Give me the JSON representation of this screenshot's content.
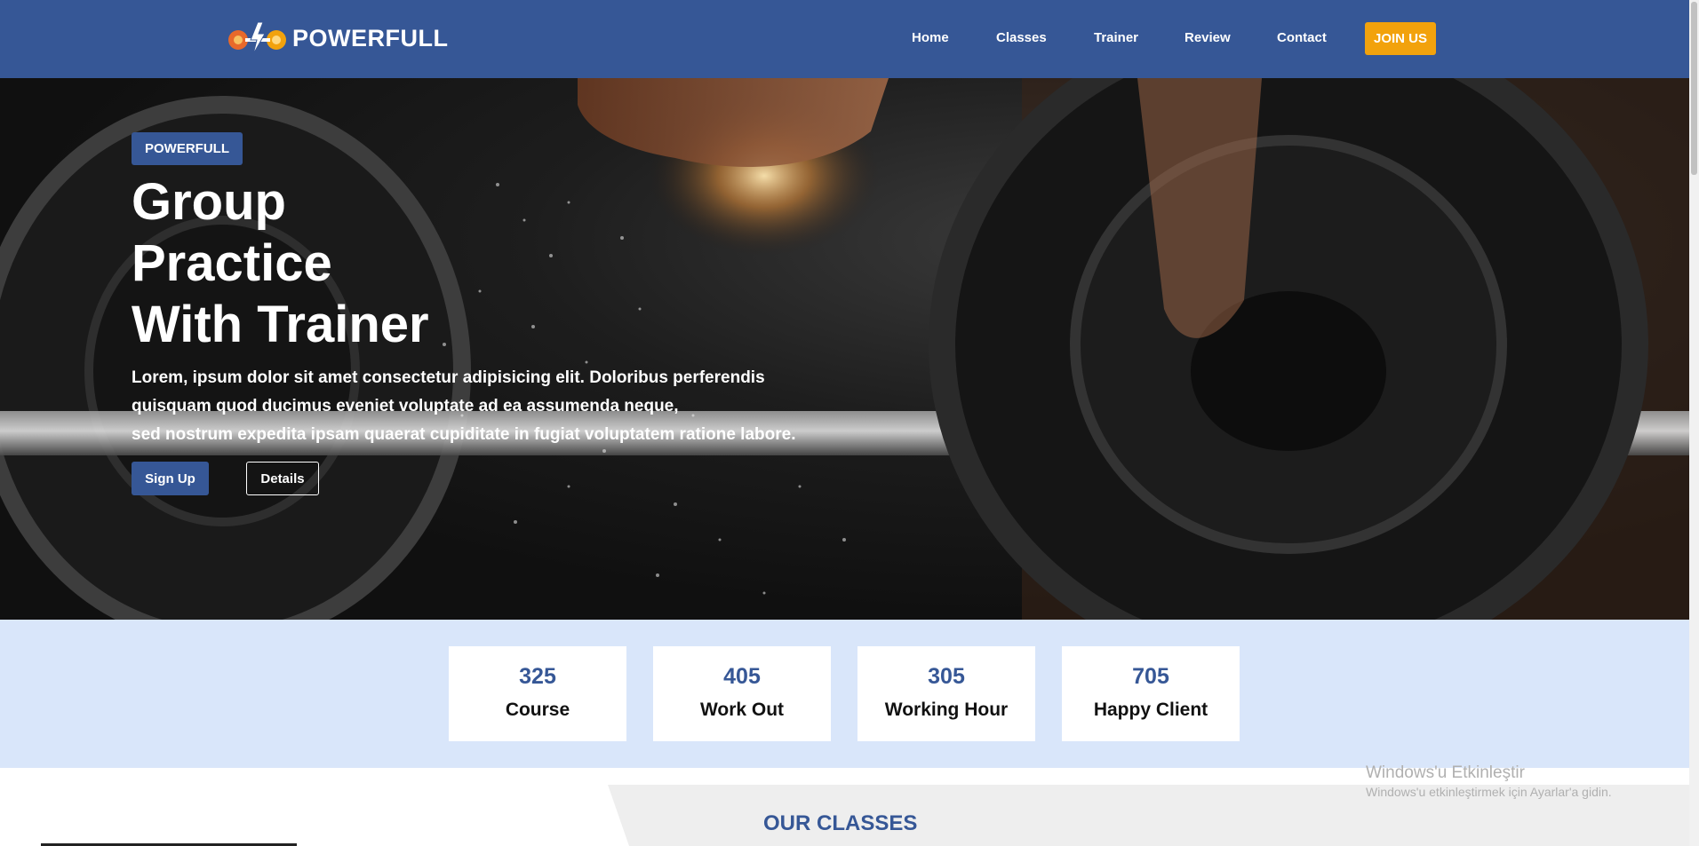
{
  "brand": {
    "name": "POWERFULL",
    "icon": "barbell-lightning-icon"
  },
  "nav": {
    "items": [
      {
        "label": "Home"
      },
      {
        "label": "Classes"
      },
      {
        "label": "Trainer"
      },
      {
        "label": "Review"
      },
      {
        "label": "Contact"
      }
    ],
    "join_label": "JOIN US"
  },
  "hero": {
    "badge": "POWERFULL",
    "title_lines": [
      "Group",
      "Practice",
      "With Trainer"
    ],
    "description_lines": [
      "Lorem, ipsum dolor sit amet consectetur adipisicing elit. Doloribus perferendis",
      "quisquam quod ducimus eveniet voluptate ad ea assumenda neque,",
      "sed nostrum expedita ipsam quaerat cupiditate in fugiat voluptatem ratione labore."
    ],
    "signup_label": "Sign Up",
    "details_label": "Details"
  },
  "stats": [
    {
      "value": "325",
      "label": "Course"
    },
    {
      "value": "405",
      "label": "Work Out"
    },
    {
      "value": "305",
      "label": "Working Hour"
    },
    {
      "value": "705",
      "label": "Happy Client"
    }
  ],
  "classes": {
    "title": "OUR CLASSES"
  },
  "watermark": {
    "title": "Windows'u Etkinleştir",
    "subtitle": "Windows'u etkinleştirmek için Ayarlar'a gidin."
  },
  "colors": {
    "primary": "#365796",
    "accent": "#f2a20c",
    "stats_bg": "#d9e6fa"
  }
}
